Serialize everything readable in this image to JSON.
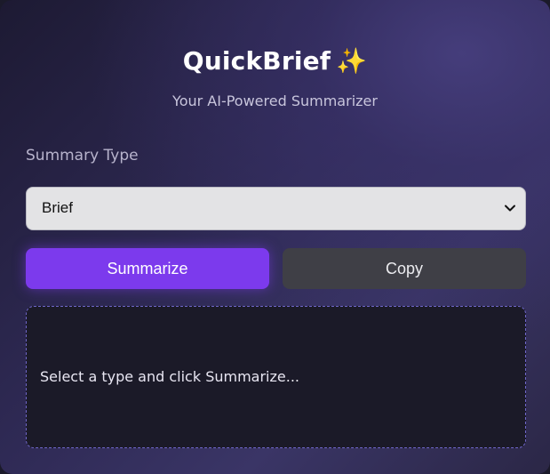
{
  "header": {
    "title": "QuickBrief",
    "title_emoji": "✨",
    "subtitle": "Your AI-Powered Summarizer"
  },
  "summary_type": {
    "label": "Summary Type",
    "selected": "Brief",
    "icon": "chevron-down-icon"
  },
  "actions": {
    "summarize_label": "Summarize",
    "copy_label": "Copy"
  },
  "output": {
    "placeholder": "Select a type and click Summarize..."
  },
  "colors": {
    "accent": "#7c3aed",
    "secondary_button": "#3f3f46",
    "output_border": "#6f66c9",
    "sparkle": "#f6c04d"
  }
}
